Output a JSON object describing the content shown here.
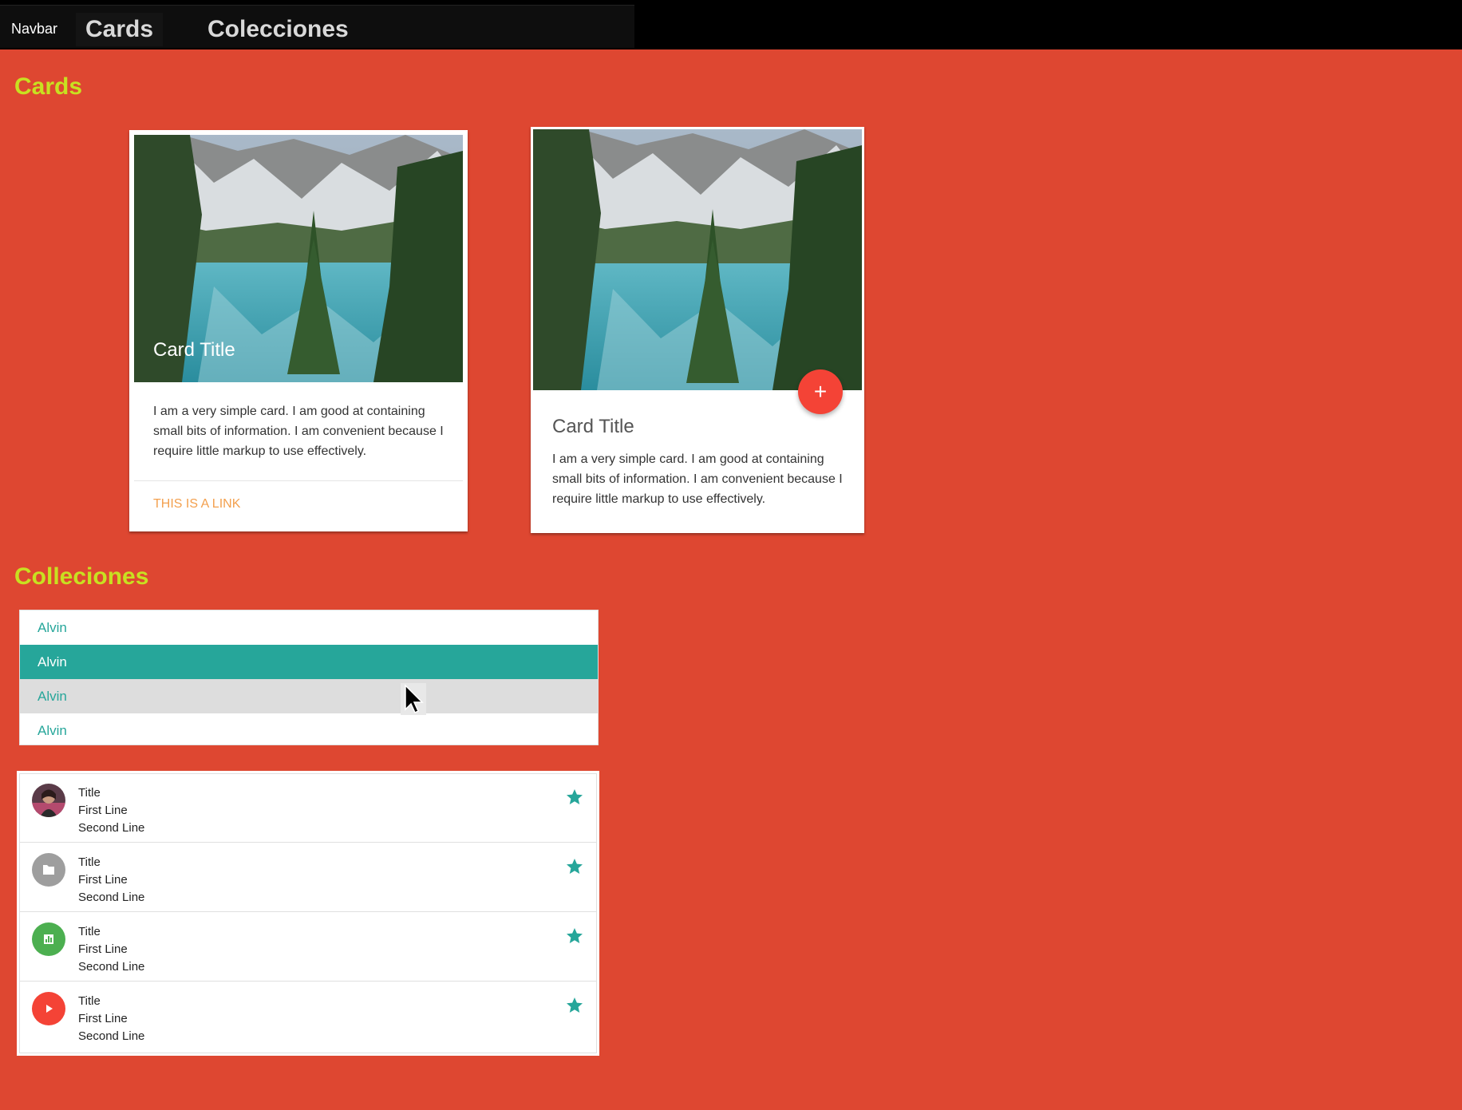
{
  "navbar": {
    "brand": "Navbar",
    "links": [
      "Cards",
      "Colecciones"
    ]
  },
  "sections": {
    "cards_title": "Cards",
    "collections_title": "Colleciones"
  },
  "card1": {
    "title": "Card Title",
    "content": "I am a very simple card. I am good at containing small bits of information. I am convenient because I require little markup to use effectively.",
    "link": "THIS IS A LINK"
  },
  "card2": {
    "title": "Card Title",
    "content": "I am a very simple card. I am good at containing small bits of information. I am convenient because I require little markup to use effectively.",
    "fab_label": "+"
  },
  "collection_links": [
    "Alvin",
    "Alvin",
    "Alvin",
    "Alvin"
  ],
  "collection_avatars": [
    {
      "title": "Title",
      "line1": "First Line",
      "line2": "Second Line",
      "icon": "person-photo-icon"
    },
    {
      "title": "Title",
      "line1": "First Line",
      "line2": "Second Line",
      "icon": "folder-icon"
    },
    {
      "title": "Title",
      "line1": "First Line",
      "line2": "Second Line",
      "icon": "chart-icon"
    },
    {
      "title": "Title",
      "line1": "First Line",
      "line2": "Second Line",
      "icon": "play-icon"
    }
  ],
  "colors": {
    "background": "#de4731",
    "section_title": "#c8e021",
    "teal": "#26a69a",
    "link_orange": "#f3a04e",
    "fab_red": "#f44336"
  }
}
